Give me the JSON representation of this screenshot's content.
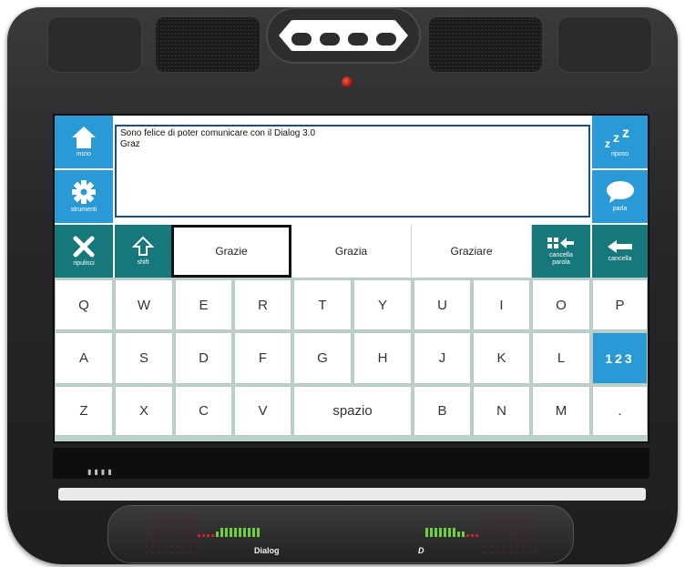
{
  "side_left": {
    "home_label": "inizio",
    "tools_label": "strumenti",
    "clear_label": "ripulisci",
    "shift_label": "shift"
  },
  "side_right": {
    "sleep_label": "riposo",
    "speak_label": "parla",
    "delete_word_label": "cancella parola",
    "delete_label": "cancella"
  },
  "message": {
    "line1": "Sono felice di poter comunicare con il Dialog 3.0",
    "line2": "Graz"
  },
  "predictions": [
    "Grazie",
    "Grazia",
    "Graziare"
  ],
  "keyboard": {
    "row1": [
      "Q",
      "W",
      "E",
      "R",
      "T",
      "Y",
      "U",
      "I",
      "O",
      "P"
    ],
    "row2": [
      "A",
      "S",
      "D",
      "F",
      "G",
      "H",
      "J",
      "K",
      "L"
    ],
    "numbers_label": "123",
    "row3": [
      "Z",
      "X",
      "C",
      "V",
      "spazio",
      "B",
      "N",
      "M",
      "."
    ]
  },
  "colors": {
    "teal": "#16787a",
    "blue": "#2a9ad6",
    "device": "#262628"
  },
  "base": {
    "left_brand": "Dialog",
    "right_brand": "D"
  }
}
